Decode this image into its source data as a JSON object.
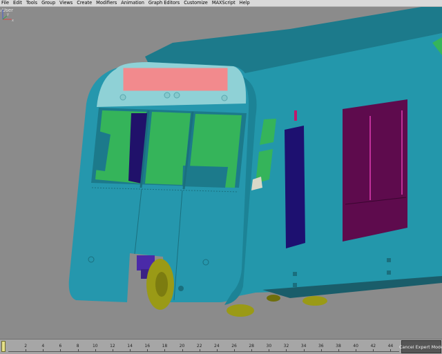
{
  "menu": [
    "File",
    "Edit",
    "Tools",
    "Group",
    "Views",
    "Create",
    "Modifiers",
    "Animation",
    "Graph Editors",
    "Customize",
    "MAXScript",
    "Help"
  ],
  "viewport": {
    "label": "User"
  },
  "axis": {
    "x": "x",
    "y": "y",
    "z": "z"
  },
  "timeline": {
    "ticks": [
      "2",
      "4",
      "6",
      "8",
      "10",
      "12",
      "14",
      "16",
      "18",
      "20",
      "22",
      "24",
      "26",
      "28",
      "30",
      "32",
      "34",
      "36",
      "38",
      "40",
      "42",
      "44"
    ],
    "cancel_label": "Cancel Expert Mode"
  },
  "colors": {
    "viewport_bg": "#8b8b8b",
    "body": "#2396ab",
    "roof": "#1e7f90",
    "front_dark": "#166f7e",
    "destination_sign": "#f08a8a",
    "windows": "#35b45a",
    "door": "#5e0b4d",
    "window_dark": "#20116a",
    "wheels": "#9a9a16"
  }
}
